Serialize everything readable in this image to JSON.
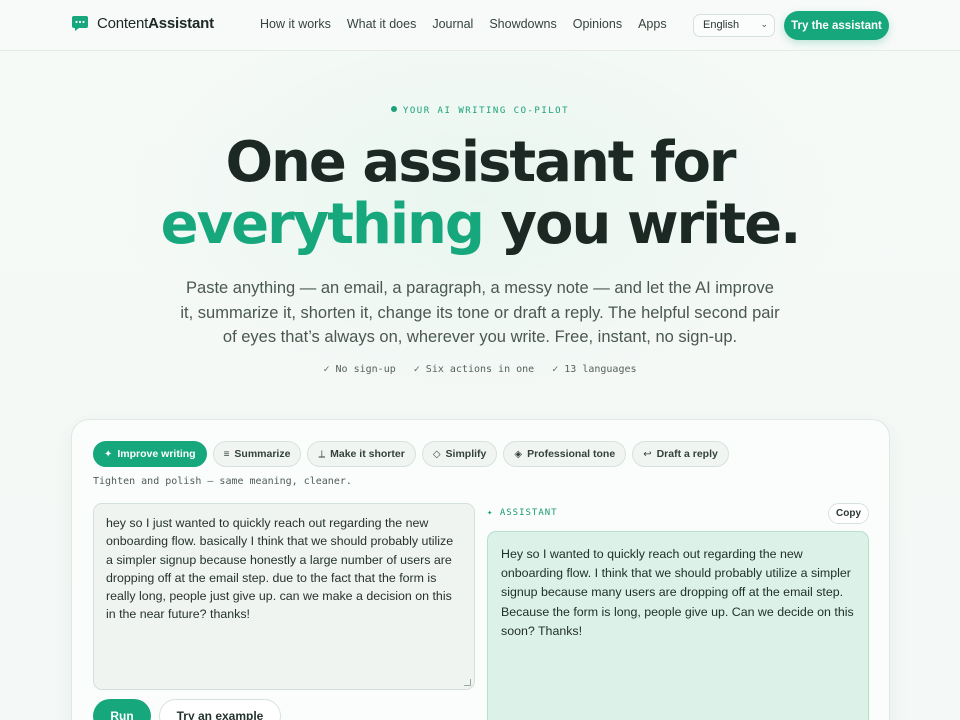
{
  "nav": {
    "brand": {
      "prefix": "Content",
      "bold": "Assistant",
      "icon": "chat-bubble-icon"
    },
    "links": [
      "How it works",
      "What it does",
      "Journal",
      "Showdowns",
      "Opinions",
      "Apps"
    ],
    "language": "English",
    "cta": "Try the assistant"
  },
  "hero": {
    "eyebrow": "YOUR AI WRITING CO-PILOT",
    "title_line1": "One assistant for",
    "title_accent": "everything",
    "title_rest": " you write.",
    "subtitle": "Paste anything — an email, a paragraph, a messy note — and let the AI improve it, summarize it, shorten it, change its tone or draft a reply. The helpful second pair of eyes that’s always on, wherever you write. Free, instant, no sign-up.",
    "checks": [
      "✓ No sign-up",
      "✓ Six actions in one",
      "✓ 13 languages"
    ]
  },
  "tool": {
    "actions": [
      {
        "icon": "✦",
        "label": "Improve writing",
        "active": true
      },
      {
        "icon": "≡",
        "label": "Summarize",
        "active": false
      },
      {
        "icon": "⟂",
        "label": "Make it shorter",
        "active": false
      },
      {
        "icon": "◇",
        "label": "Simplify",
        "active": false
      },
      {
        "icon": "◈",
        "label": "Professional tone",
        "active": false
      },
      {
        "icon": "↩",
        "label": "Draft a reply",
        "active": false
      }
    ],
    "hint": "Tighten and polish — same meaning, cleaner.",
    "input_text": "hey so I just wanted to quickly reach out regarding the new onboarding flow. basically I think that we should probably utilize a simpler signup because honestly a large number of users are dropping off at the email step. due to the fact that the form is really long, people just give up. can we make a decision on this in the near future? thanks!",
    "assistant_label": "✦ ASSISTANT",
    "copy_label": "Copy",
    "output_text": "Hey so I wanted to quickly reach out regarding the new onboarding flow. I think that we should probably utilize a simpler signup because many users are dropping off at the email step. Because the form is long, people give up. Can we decide on this soon? Thanks!",
    "run_label": "Run",
    "example_label": "Try an example"
  },
  "colors": {
    "accent": "#16a77c",
    "text": "#1b2823",
    "output_bg": "#dcf2e8"
  }
}
